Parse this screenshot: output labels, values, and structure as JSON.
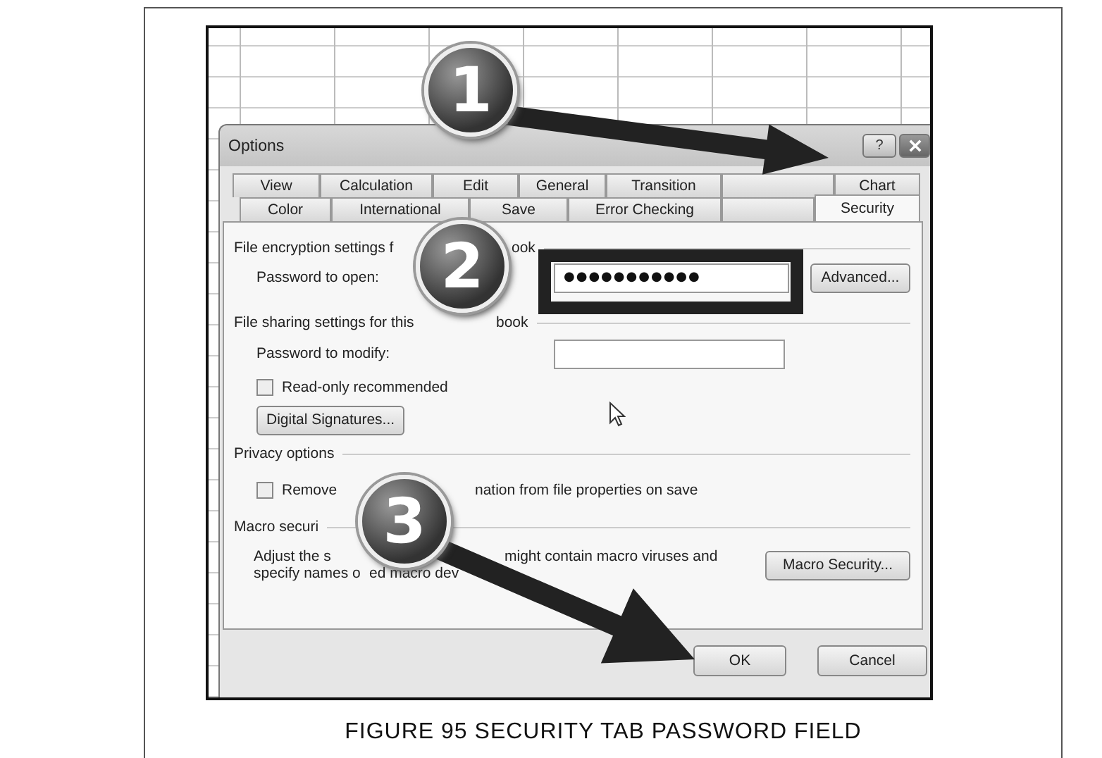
{
  "screenshot": {
    "dialog": {
      "title": "Options",
      "help_button": "?",
      "tab_rows": [
        [
          {
            "label": "View",
            "selected": false
          },
          {
            "label": "Calculation",
            "selected": false
          },
          {
            "label": "Edit",
            "selected": false
          },
          {
            "label": "General",
            "selected": false
          },
          {
            "label": "Transition",
            "selected": false
          },
          {
            "selected": false
          },
          {
            "label": "Chart",
            "selected": false
          }
        ],
        [
          {
            "label": "Color",
            "selected": false
          },
          {
            "label": "International",
            "selected": false
          },
          {
            "label": "Save",
            "selected": false
          },
          {
            "label": "Error Checking",
            "selected": false
          },
          {
            "selected": false
          },
          {
            "label": "Security",
            "selected": true
          }
        ]
      ],
      "encryption": {
        "heading_parts": [
          "File encryption settings f",
          "ook"
        ],
        "password_label": "Password to open:",
        "password_value": "●●●●●●●●●●●",
        "advanced_button": "Advanced..."
      },
      "sharing": {
        "heading_parts": [
          "File sharing settings for this",
          "book"
        ],
        "password_label": "Password to modify:",
        "read_only": {
          "label": "Read-only recommended",
          "checked": false
        },
        "signatures_button": "Digital Signatures..."
      },
      "privacy": {
        "heading": "Privacy options",
        "remove": {
          "label_parts": [
            "Remove",
            "nation from file properties on save"
          ],
          "checked": false
        }
      },
      "macro": {
        "heading": "Macro securi",
        "text_lines": [
          [
            "Adjust the s",
            "might contain macro viruses and"
          ],
          [
            "specify names o",
            "ed macro dev"
          ]
        ],
        "macro_button": "Macro Security..."
      },
      "buttons": [
        "OK",
        "Cancel"
      ]
    },
    "badges": [
      "1",
      "2",
      "3"
    ]
  },
  "caption": "FIGURE 95 SECURITY TAB PASSWORD FIELD"
}
